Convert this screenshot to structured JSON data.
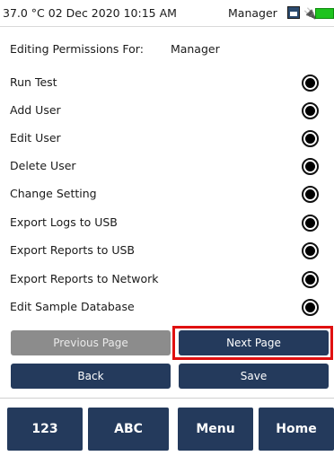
{
  "status": {
    "text": "37.0 °C 02 Dec 2020 10:15 AM",
    "user": "Manager",
    "icons": [
      "keyboard-icon",
      "plug-icon",
      "battery-icon"
    ],
    "battery_color": "#1ec31e"
  },
  "header": {
    "label": "Editing Permissions For:",
    "role": "Manager"
  },
  "permissions": [
    {
      "label": "Run Test",
      "selected": true
    },
    {
      "label": "Add User",
      "selected": true
    },
    {
      "label": "Edit User",
      "selected": true
    },
    {
      "label": "Delete User",
      "selected": true
    },
    {
      "label": "Change Setting",
      "selected": true
    },
    {
      "label": "Export Logs to USB",
      "selected": true
    },
    {
      "label": "Export Reports to USB",
      "selected": true
    },
    {
      "label": "Export Reports to Network",
      "selected": true
    },
    {
      "label": "Edit Sample Database",
      "selected": true
    }
  ],
  "buttons": {
    "previous": "Previous Page",
    "next": "Next Page",
    "back": "Back",
    "save": "Save"
  },
  "tabs": [
    "123",
    "ABC",
    "Menu",
    "Home"
  ],
  "colors": {
    "button_primary": "#243a5c",
    "button_disabled": "#8c8c8c",
    "highlight": "#e01010"
  }
}
